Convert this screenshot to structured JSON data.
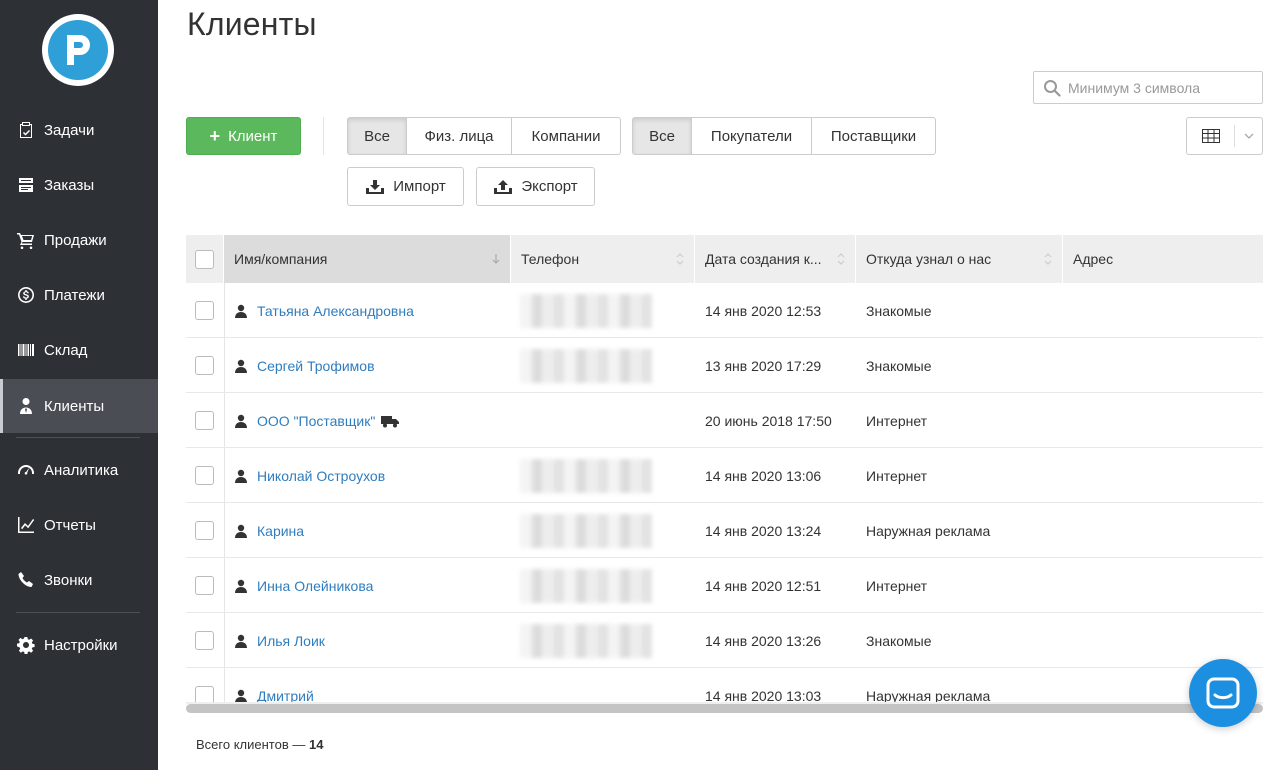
{
  "sidebar": {
    "items": [
      {
        "label": "Задачи",
        "icon": "clipboard-check-icon"
      },
      {
        "label": "Заказы",
        "icon": "orders-stack-icon"
      },
      {
        "label": "Продажи",
        "icon": "cart-icon"
      },
      {
        "label": "Платежи",
        "icon": "dollar-circle-icon"
      },
      {
        "label": "Склад",
        "icon": "barcode-icon"
      },
      {
        "label": "Клиенты",
        "icon": "user-tie-icon",
        "active": true
      },
      {
        "label": "Аналитика",
        "icon": "gauge-icon"
      },
      {
        "label": "Отчеты",
        "icon": "line-chart-icon"
      },
      {
        "label": "Звонки",
        "icon": "phone-icon"
      },
      {
        "label": "Настройки",
        "icon": "gear-icon"
      }
    ]
  },
  "header": {
    "title": "Клиенты"
  },
  "search": {
    "placeholder": "Минимум 3 символа"
  },
  "toolbar": {
    "add_label": "Клиент",
    "type_filter": [
      "Все",
      "Физ. лица",
      "Компании"
    ],
    "role_filter": [
      "Все",
      "Покупатели",
      "Поставщики"
    ],
    "import_label": "Импорт",
    "export_label": "Экспорт"
  },
  "table": {
    "columns": [
      "Имя/компания",
      "Телефон",
      "Дата создания к...",
      "Откуда узнал о нас",
      "Адрес"
    ],
    "rows": [
      {
        "name": "Татьяна Александровна",
        "date": "14 янв 2020 12:53",
        "source": "Знакомые"
      },
      {
        "name": "Сергей Трофимов",
        "date": "13 янв 2020 17:29",
        "source": "Знакомые"
      },
      {
        "name": "ООО \"Поставщик\"",
        "date": "20 июнь 2018 17:50",
        "source": "Интернет"
      },
      {
        "name": "Николай Остроухов",
        "date": "14 янв 2020 13:06",
        "source": "Интернет"
      },
      {
        "name": "Карина",
        "date": "14 янв 2020 13:24",
        "source": "Наружная реклама"
      },
      {
        "name": "Инна Олейникова",
        "date": "14 янв 2020 12:51",
        "source": "Интернет"
      },
      {
        "name": "Илья Лоик",
        "date": "14 янв 2020 13:26",
        "source": "Знакомые"
      },
      {
        "name": "Дмитрий",
        "date": "14 янв 2020 13:03",
        "source": "Наружная реклама"
      }
    ]
  },
  "footer": {
    "total_label": "Всего клиентов —",
    "total_value": "14"
  },
  "colors": {
    "sidebar_bg": "#2d3136",
    "accent_green": "#5cb85c",
    "link_blue": "#2f7dbf",
    "chat_blue": "#1d8fe0",
    "logo_blue": "#2f9fd8"
  }
}
